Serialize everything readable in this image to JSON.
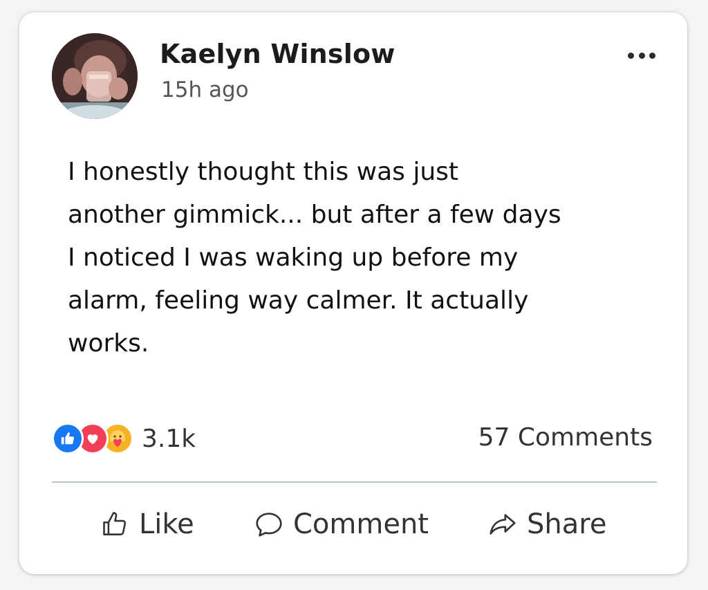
{
  "post": {
    "author": "Kaelyn Winslow",
    "time": "15h ago",
    "body": "I honestly thought this was just\nanother gimmick... but after a few days\nI noticed I was waking up before my\nalarm, feeling way calmer. It actually\nworks."
  },
  "reactions": {
    "icons": [
      "like-icon",
      "love-icon",
      "care-icon"
    ],
    "count": "3.1k"
  },
  "comments": {
    "count_label": "57 Comments"
  },
  "actions": {
    "like_label": "Like",
    "comment_label": "Comment",
    "share_label": "Share"
  },
  "colors": {
    "like": "#1877f2",
    "love": "#f33e58",
    "care": "#f7b125",
    "text": "#111111",
    "muted": "#555555"
  }
}
